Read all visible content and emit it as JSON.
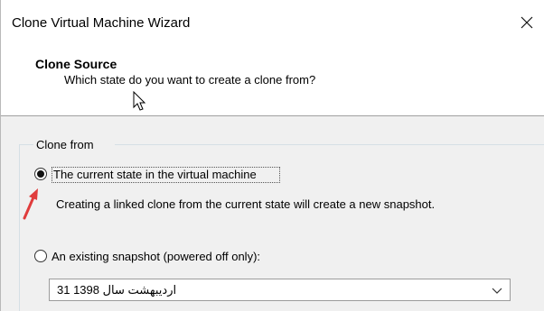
{
  "window": {
    "title": "Clone Virtual Machine Wizard"
  },
  "header": {
    "title": "Clone Source",
    "subtitle": "Which state do you want to create a clone from?"
  },
  "group": {
    "legend": "Clone from"
  },
  "options": {
    "current": {
      "label": "The current state in the virtual machine",
      "description": "Creating a linked clone from the current state will create a new snapshot.",
      "selected": true
    },
    "snapshot": {
      "label": "An existing snapshot (powered off only):",
      "selected": false
    }
  },
  "snapshot_select": {
    "value": "31 1398 اردیبهشت سال"
  },
  "colors": {
    "body_background": "#f0f0f0",
    "header_background": "#ffffff",
    "annotation_arrow": "#e03c3c"
  },
  "icons": {
    "close": "close-icon",
    "cursor": "mouse-pointer-icon",
    "arrow": "red-annotation-arrow-icon",
    "chevron": "chevron-down-icon"
  }
}
